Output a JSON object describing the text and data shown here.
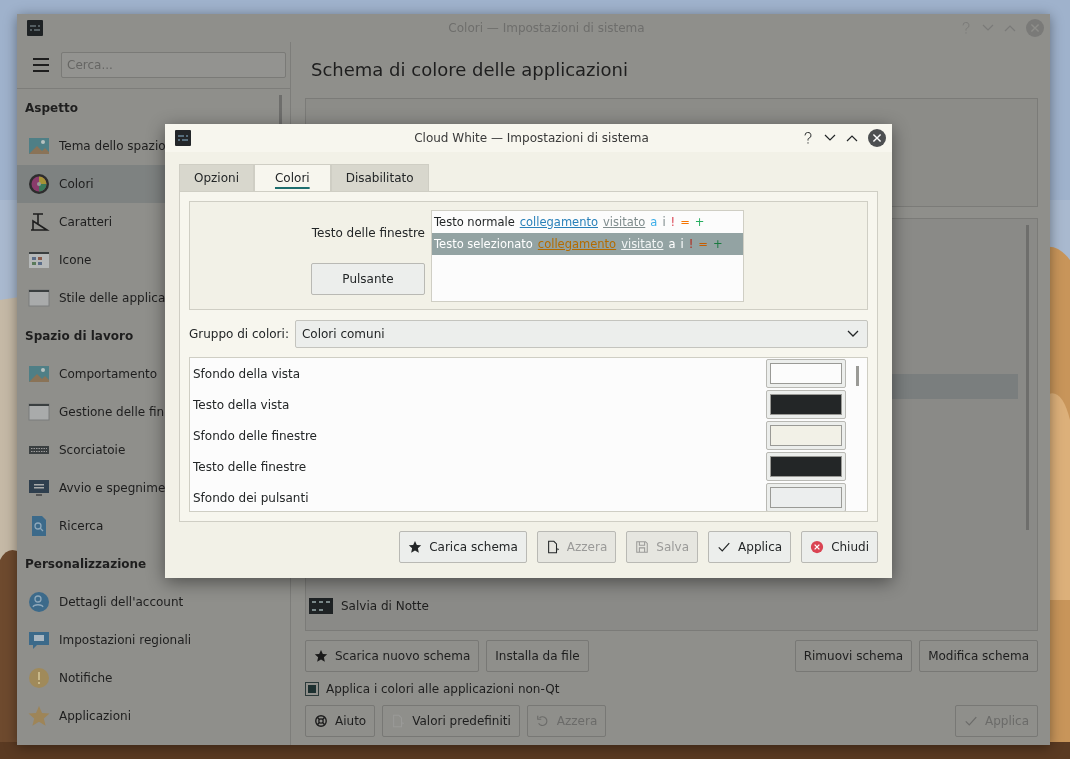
{
  "main_window": {
    "title": "Colori — Impostazioni di sistema",
    "search": {
      "placeholder": "Cerca..."
    },
    "sidebar": [
      {
        "heading": "Aspetto",
        "items": [
          {
            "label": "Tema dello spazio",
            "selected": false
          },
          {
            "label": "Colori",
            "selected": true
          },
          {
            "label": "Caratteri",
            "selected": false
          },
          {
            "label": "Icone",
            "selected": false
          },
          {
            "label": "Stile delle applica",
            "selected": false
          }
        ]
      },
      {
        "heading": "Spazio di lavoro",
        "items": [
          {
            "label": "Comportamento",
            "selected": false
          },
          {
            "label": "Gestione delle fin",
            "selected": false
          },
          {
            "label": "Scorciatoie",
            "selected": false
          },
          {
            "label": "Avvio e spegnime",
            "selected": false
          },
          {
            "label": "Ricerca",
            "selected": false
          }
        ]
      },
      {
        "heading": "Personalizzazione",
        "items": [
          {
            "label": "Dettagli dell'account",
            "selected": false
          },
          {
            "label": "Impostazioni regionali",
            "selected": false
          },
          {
            "label": "Notifiche",
            "selected": false
          },
          {
            "label": "Applicazioni",
            "selected": false
          }
        ]
      }
    ],
    "page_title": "Schema di colore delle applicazioni",
    "schemes": [
      {
        "label": "Salvia di Notte"
      }
    ],
    "scheme_buttons": [
      {
        "label": "Scarica nuovo schema",
        "kind": "star"
      },
      {
        "label": "Installa da file",
        "kind": "plain"
      },
      {
        "label": "Rimuovi schema",
        "kind": "plain"
      },
      {
        "label": "Modifica schema",
        "kind": "plain"
      }
    ],
    "non_qt": {
      "label": "Applica i colori alle applicazioni non-Qt",
      "checked": true
    },
    "footer_buttons": [
      {
        "label": "Aiuto",
        "kind": "help",
        "disabled": false
      },
      {
        "label": "Valori predefiniti",
        "kind": "defaults",
        "disabled": false
      },
      {
        "label": "Azzera",
        "kind": "undo",
        "disabled": true
      },
      {
        "label": "Applica",
        "kind": "check",
        "disabled": true
      }
    ]
  },
  "dialog": {
    "title": "Cloud White — Impostazioni di sistema",
    "tabs": [
      {
        "label": "Opzioni",
        "selected": false
      },
      {
        "label": "Colori",
        "selected": true
      },
      {
        "label": "Disabilitato",
        "selected": false
      }
    ],
    "preview": {
      "label": "Testo delle finestre",
      "button": "Pulsante",
      "normal_row": [
        {
          "text": "Testo normale",
          "kind": "text"
        },
        {
          "text": "collegamento",
          "kind": "link"
        },
        {
          "text": "visitato",
          "kind": "visited"
        },
        {
          "text": "a",
          "kind": "active"
        },
        {
          "text": "i",
          "kind": "inactive"
        },
        {
          "text": "!",
          "kind": "negative"
        },
        {
          "text": "=",
          "kind": "neutral"
        },
        {
          "text": "+",
          "kind": "positive"
        }
      ],
      "selected_row": [
        {
          "text": "Testo selezionato",
          "kind": "text"
        },
        {
          "text": "collegamento",
          "kind": "link"
        },
        {
          "text": "visitato",
          "kind": "visited"
        },
        {
          "text": "a",
          "kind": "active"
        },
        {
          "text": "i",
          "kind": "inactive"
        },
        {
          "text": "!",
          "kind": "negative"
        },
        {
          "text": "=",
          "kind": "neutral"
        },
        {
          "text": "+",
          "kind": "positive"
        }
      ]
    },
    "group": {
      "label": "Gruppo di colori:",
      "value": "Colori comuni"
    },
    "colors": [
      {
        "label": "Sfondo della vista",
        "color": "#fcfcfc"
      },
      {
        "label": "Testo della vista",
        "color": "#232627"
      },
      {
        "label": "Sfondo delle finestre",
        "color": "#f2f1e7"
      },
      {
        "label": "Testo delle finestre",
        "color": "#232627"
      },
      {
        "label": "Sfondo dei pulsanti",
        "color": "#eceeee"
      }
    ],
    "buttons": [
      {
        "label": "Carica schema",
        "kind": "star",
        "disabled": false
      },
      {
        "label": "Azzera",
        "kind": "defaults",
        "disabled": true
      },
      {
        "label": "Salva",
        "kind": "save",
        "disabled": true
      },
      {
        "label": "Applica",
        "kind": "check",
        "disabled": false
      },
      {
        "label": "Chiudi",
        "kind": "close",
        "disabled": false
      }
    ]
  }
}
